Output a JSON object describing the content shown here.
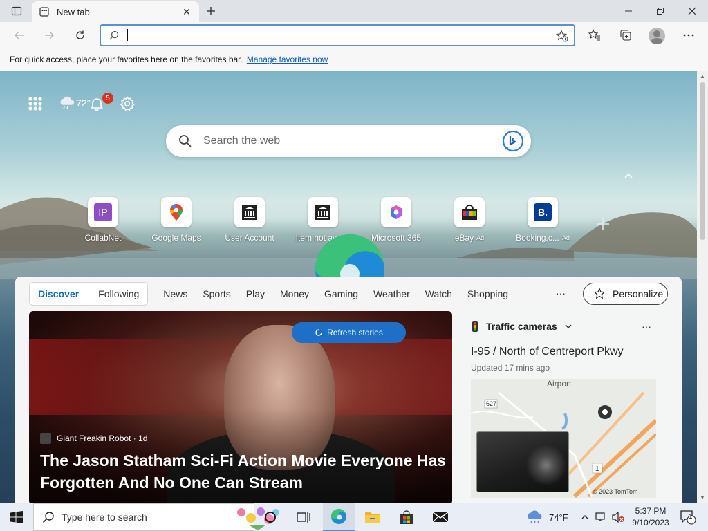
{
  "browser": {
    "tab_title": "New tab",
    "favorites_prompt": "For quick access, place your favorites here on the favorites bar.",
    "manage_favorites": "Manage favorites now"
  },
  "ntp": {
    "temperature": "72°",
    "notification_count": "5",
    "search_placeholder": "Search the web",
    "quick_links": [
      {
        "label": "CollabNet",
        "ad": "",
        "icon": "collabnet-icon"
      },
      {
        "label": "Google Maps",
        "ad": "",
        "icon": "google-maps-icon"
      },
      {
        "label": "User Account",
        "ad": "",
        "icon": "building-icon"
      },
      {
        "label": "Item not avai...",
        "ad": "",
        "icon": "building-icon"
      },
      {
        "label": "Microsoft 365",
        "ad": "",
        "icon": "microsoft-365-icon"
      },
      {
        "label": "eBay",
        "ad": "Ad",
        "icon": "ebay-bag-icon"
      },
      {
        "label": "Booking.c...",
        "ad": "Ad",
        "icon": "booking-icon"
      }
    ]
  },
  "feed": {
    "tabs": [
      "Discover",
      "Following"
    ],
    "nav": [
      "News",
      "Sports",
      "Play",
      "Money",
      "Gaming",
      "Weather",
      "Watch",
      "Shopping"
    ],
    "more": "···",
    "personalize": "Personalize",
    "refresh": "Refresh stories",
    "hero": {
      "source": "Giant Freakin Robot · 1d",
      "headline": "The Jason Statham Sci-Fi Action Movie Everyone Has Forgotten And No One Can Stream"
    },
    "traffic": {
      "title": "Traffic cameras",
      "location": "I-95 / North of Centreport Pkwy",
      "updated": "Updated 17 mins ago",
      "map_label": "Airport",
      "road_627": "627",
      "road_1": "1",
      "copyright": "© 2023 TomTom"
    }
  },
  "taskbar": {
    "search_placeholder": "Type here to search",
    "weather": "74°F",
    "time": "5:37 PM",
    "date": "9/10/2023",
    "notifications": "1"
  },
  "colors": {
    "accent": "#0f6cbd",
    "refresh_button": "#1f6fc6",
    "badge": "#d9331c"
  }
}
